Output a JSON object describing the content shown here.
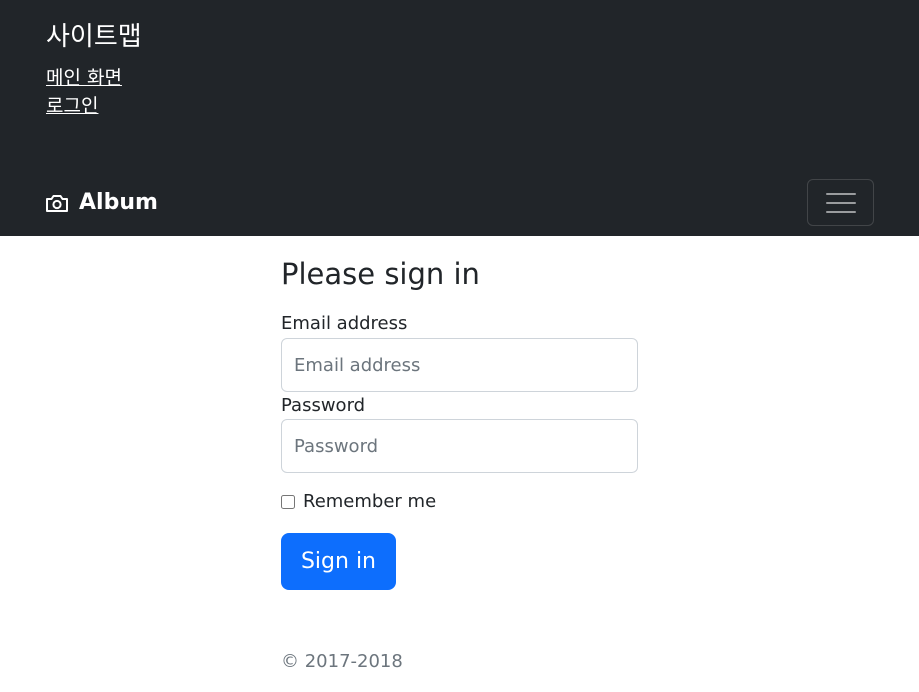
{
  "sitemap": {
    "title": "사이트맵",
    "links": [
      "메인 화면",
      "로그인"
    ]
  },
  "navbar": {
    "brand_icon": "camera-icon",
    "brand": "Album",
    "toggler_icon": "hamburger-menu-icon"
  },
  "form": {
    "title": "Please sign in",
    "email_label": "Email address",
    "email_placeholder": "Email address",
    "password_label": "Password",
    "password_placeholder": "Password",
    "remember_label": "Remember me",
    "remember_checked": false,
    "submit_label": "Sign in"
  },
  "footer": {
    "copyright": "© 2017-2018"
  },
  "colors": {
    "header_bg": "#212529",
    "primary": "#0d6efd",
    "muted": "#6c757d"
  }
}
